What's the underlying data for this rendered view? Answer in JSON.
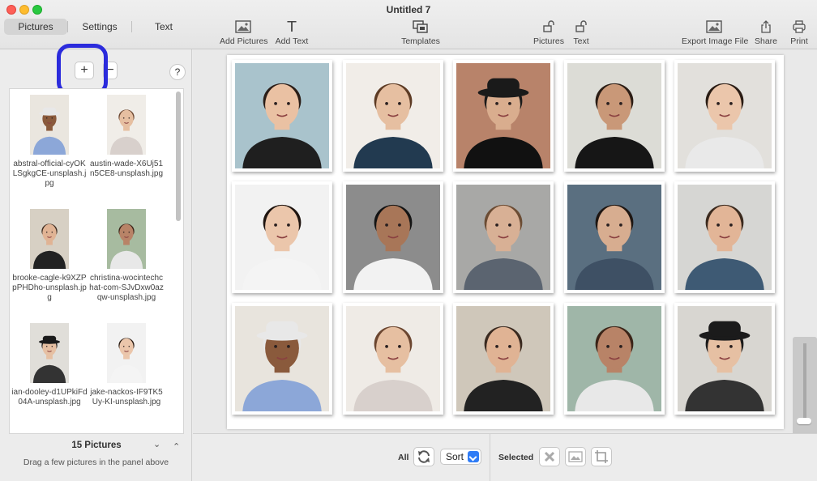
{
  "window": {
    "title": "Untitled 7"
  },
  "tabs": [
    {
      "label": "Pictures",
      "active": true
    },
    {
      "label": "Settings",
      "active": false
    },
    {
      "label": "Text",
      "active": false
    }
  ],
  "toolbar": {
    "add_pictures": "Add Pictures",
    "add_text": "Add Text",
    "templates": "Templates",
    "lock_pictures": "Pictures",
    "lock_text": "Text",
    "export": "Export Image File",
    "share": "Share",
    "print": "Print"
  },
  "sidebar": {
    "add_symbol": "+",
    "remove_symbol": "−",
    "help_symbol": "?",
    "thumbnails": [
      {
        "name": "abstral-official-cyOKLSgkgCE-unsplash.jpg",
        "skin": "#8a5a3c",
        "bg": "#eae6df",
        "shirt": "#8ca7d8",
        "hair": "#e8e8e8",
        "hat": true
      },
      {
        "name": "austin-wade-X6Uj51n5CE8-unsplash.jpg",
        "skin": "#e6bfa1",
        "bg": "#f0ede8",
        "shirt": "#d8d0cc",
        "hair": "#6b4630",
        "hat": false
      },
      {
        "name": "brooke-cagle-k9XZPpPHDho-unsplash.jpg",
        "skin": "#e0b394",
        "bg": "#d7d0c4",
        "shirt": "#222222",
        "hair": "#3a2a20",
        "hat": false
      },
      {
        "name": "christina-wocintechchat-com-SJvDxw0azqw-unsplash.jpg",
        "skin": "#b88367",
        "bg": "#a7bba0",
        "shirt": "#e8e8e8",
        "hair": "#3a2418",
        "hat": false
      },
      {
        "name": "ian-dooley-d1UPkiFd04A-unsplash.jpg",
        "skin": "#e6c0a3",
        "bg": "#e0ded9",
        "shirt": "#333333",
        "hair": "#1b1b1b",
        "hat": true
      },
      {
        "name": "jake-nackos-IF9TK5Uy-KI-unsplash.jpg",
        "skin": "#ebc6ab",
        "bg": "#f2f2f2",
        "shirt": "#f4f4f4",
        "hair": "#2a1c14",
        "hat": false
      }
    ],
    "count_label": "15 Pictures",
    "collapse_symbol": "⌄",
    "expand_symbol": "⌃",
    "hint": "Drag a few pictures in the panel above"
  },
  "photos": [
    {
      "bg": "#a9c3cc",
      "skin": "#eac1a3",
      "hair": "#2a1d17",
      "shirt": "#1f1f1f",
      "hat": false
    },
    {
      "bg": "#f1ede8",
      "skin": "#e6bfa1",
      "hair": "#5d3b24",
      "shirt": "#223a50",
      "hat": false
    },
    {
      "bg": "#b8836a",
      "skin": "#d9ad8e",
      "hair": "#1a1a1a",
      "shirt": "#111111",
      "hat": true
    },
    {
      "bg": "#dcdcd6",
      "skin": "#c99878",
      "hair": "#2b1d15",
      "shirt": "#161616",
      "hat": false
    },
    {
      "bg": "#e2e0dc",
      "skin": "#ebc6ab",
      "hair": "#2a1c14",
      "shirt": "#e9e9e9",
      "hat": false
    },
    {
      "bg": "#f2f2f2",
      "skin": "#ebc6ab",
      "hair": "#1f1510",
      "shirt": "#f4f4f4",
      "hat": false
    },
    {
      "bg": "#8c8c8c",
      "skin": "#a87658",
      "hair": "#141414",
      "shirt": "#f2f2f2",
      "hat": false
    },
    {
      "bg": "#a8a8a6",
      "skin": "#d8b095",
      "hair": "#6b4c34",
      "shirt": "#5b6470",
      "hat": false
    },
    {
      "bg": "#5a6f80",
      "skin": "#d7ad90",
      "hair": "#1e1612",
      "shirt": "#3e5064",
      "hat": false
    },
    {
      "bg": "#d6d6d3",
      "skin": "#e2b597",
      "hair": "#3b2a1e",
      "shirt": "#3e5a74",
      "hat": false
    },
    {
      "bg": "#e8e4dd",
      "skin": "#8a5a3c",
      "hair": "#e8e8e8",
      "shirt": "#8ca7d8",
      "hat": true
    },
    {
      "bg": "#efebe6",
      "skin": "#e6bfa1",
      "hair": "#6b4630",
      "shirt": "#d8d0cc",
      "hat": false
    },
    {
      "bg": "#cfc7ba",
      "skin": "#e0b394",
      "hair": "#3a2a20",
      "shirt": "#222222",
      "hat": false
    },
    {
      "bg": "#9fb6a8",
      "skin": "#b88367",
      "hair": "#3a2418",
      "shirt": "#e8e8e8",
      "hat": false
    },
    {
      "bg": "#d8d6d1",
      "skin": "#e6c0a3",
      "hair": "#1b1b1b",
      "shirt": "#333333",
      "hat": true
    }
  ],
  "bottom": {
    "all_label": "All",
    "sort_label": "Sort",
    "selected_label": "Selected"
  }
}
